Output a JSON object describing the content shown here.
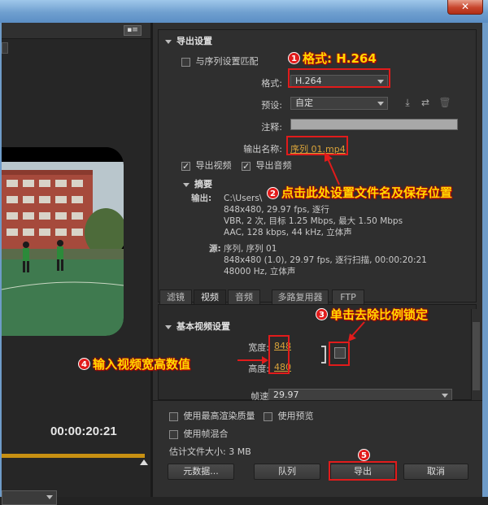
{
  "window": {
    "close_glyph": "✕"
  },
  "preview": {
    "timecode": "00:00:20:21",
    "menu_glyph": "▪≡"
  },
  "export_settings": {
    "title": "导出设置",
    "match_sequence_label": "与序列设置匹配",
    "format_label": "格式:",
    "format_value": "H.264",
    "preset_label": "预设:",
    "preset_value": "自定",
    "comments_label": "注释:",
    "output_name_label": "输出名称:",
    "output_name_value": "序列 01.mp4",
    "export_video_label": "导出视频",
    "export_audio_label": "导出音频",
    "summary": {
      "title": "摘要",
      "output_label": "输出:",
      "output_lines": [
        "C:\\Users\\",
        "848x480, 29.97 fps, 逐行",
        "VBR, 2 次, 目标 1.25 Mbps, 最大 1.50 Mbps",
        "AAC, 128 kbps, 44 kHz, 立体声"
      ],
      "source_label": "源:",
      "source_lines": [
        "序列, 序列 01",
        "848x480 (1.0), 29.97 fps, 逐行扫描, 00:00:20:21",
        "48000 Hz, 立体声"
      ]
    }
  },
  "tabs": [
    "滤镜",
    "视频",
    "音频",
    "多路复用器",
    "FTP"
  ],
  "video_settings": {
    "title": "基本视频设置",
    "width_label": "宽度:",
    "width_value": "848",
    "height_label": "高度:",
    "height_value": "480",
    "framerate_label": "帧速率:",
    "framerate_value": "29.97"
  },
  "bottom": {
    "max_render_quality_label": "使用最高渲染质量",
    "use_preview_label": "使用预览",
    "frame_blending_label": "使用帧混合",
    "estimated_size": "估计文件大小: 3 MB",
    "buttons": {
      "metadata": "元数据...",
      "queue": "队列",
      "export": "导出",
      "cancel": "取消"
    }
  },
  "annotations": [
    {
      "num": "1",
      "text": "格式: H.264"
    },
    {
      "num": "2",
      "text": "点击此处设置文件名及保存位置"
    },
    {
      "num": "3",
      "text": "单击去除比例锁定"
    },
    {
      "num": "4",
      "text": "输入视频宽高数值"
    },
    {
      "num": "5",
      "text": ""
    }
  ],
  "colors": {
    "annotation_red": "#e11b1b",
    "annotation_yellow": "#ffd900",
    "link_yellow": "#d8a23a",
    "timeline_orange": "#c79012"
  }
}
